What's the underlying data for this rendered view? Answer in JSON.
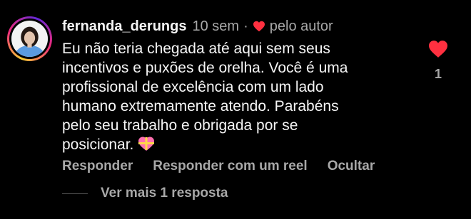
{
  "comment": {
    "username": "fernanda_derungs",
    "time": "10 sem",
    "separator": "·",
    "liked_by_author": "pelo autor",
    "text": "Eu não teria chegada até aqui sem seus\nincentivos e puxões de orelha. Você é uma\nprofissional de excelência com um lado\nhumano extremamente atendo. Parabéns\npelo seu trabalho e obrigada por se\nposicionar.",
    "emoji": "💝",
    "like_count": "1",
    "accent_heart_color": "#ff3040"
  },
  "actions": {
    "reply": "Responder",
    "reply_reel": "Responder com um reel",
    "hide": "Ocultar"
  },
  "replies": {
    "more_label": "Ver mais 1 resposta"
  },
  "icons": {
    "small_heart": "heart-filled-icon",
    "like": "heart-filled-icon",
    "emoji": "gift-heart-icon"
  }
}
